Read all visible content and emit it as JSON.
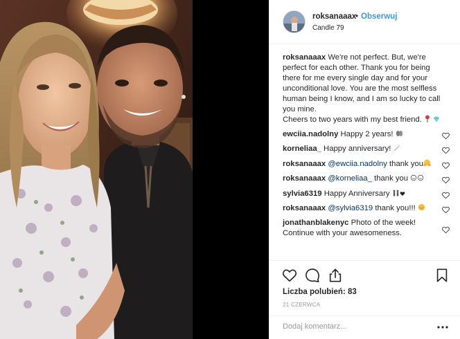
{
  "post": {
    "username": "roksanaaax",
    "separator": "•",
    "follow_label": "Obserwuj",
    "location": "Candle 79"
  },
  "caption": {
    "username": "roksanaaax",
    "text": "We're not perfect. But, we're perfect for each other. Thank you for being there for me every single day and for your unconditional love. You are the most selfless human being I know, and I am so lucky to call you mine.",
    "text2": "Cheers to two years with my best friend."
  },
  "comments": [
    {
      "user": "ewciia.nadolny",
      "text": "Happy 2 years!"
    },
    {
      "user": "korneliaa_",
      "text": "Happy anniversary!"
    },
    {
      "user": "roksanaaax",
      "mention": "@ewciia.nadolny",
      "text": "thank you"
    },
    {
      "user": "roksanaaax",
      "mention": "@korneliaa_",
      "text": "thank you"
    },
    {
      "user": "sylvia6319",
      "text": "Happy Anniversary"
    },
    {
      "user": "roksanaaax",
      "mention": "@sylvia6319",
      "text": "thank you!!!"
    },
    {
      "user": "jonathanblakenyc",
      "text": "Photo of the week! Continue with your awesomeness."
    }
  ],
  "actions": {
    "likes_label": "Liczba polubień:",
    "likes_count": "83",
    "date": "21 CZERWCA",
    "comment_placeholder": "Dodaj komentarz..."
  },
  "icons": {
    "like": "heart-outline-icon",
    "comment": "speech-bubble-icon",
    "share": "share-icon",
    "save": "bookmark-icon",
    "more": "ellipsis-icon"
  },
  "colors": {
    "link": "#3897f0",
    "text": "#262626",
    "muted": "#999999",
    "mention": "#003569",
    "border": "#efefef"
  }
}
